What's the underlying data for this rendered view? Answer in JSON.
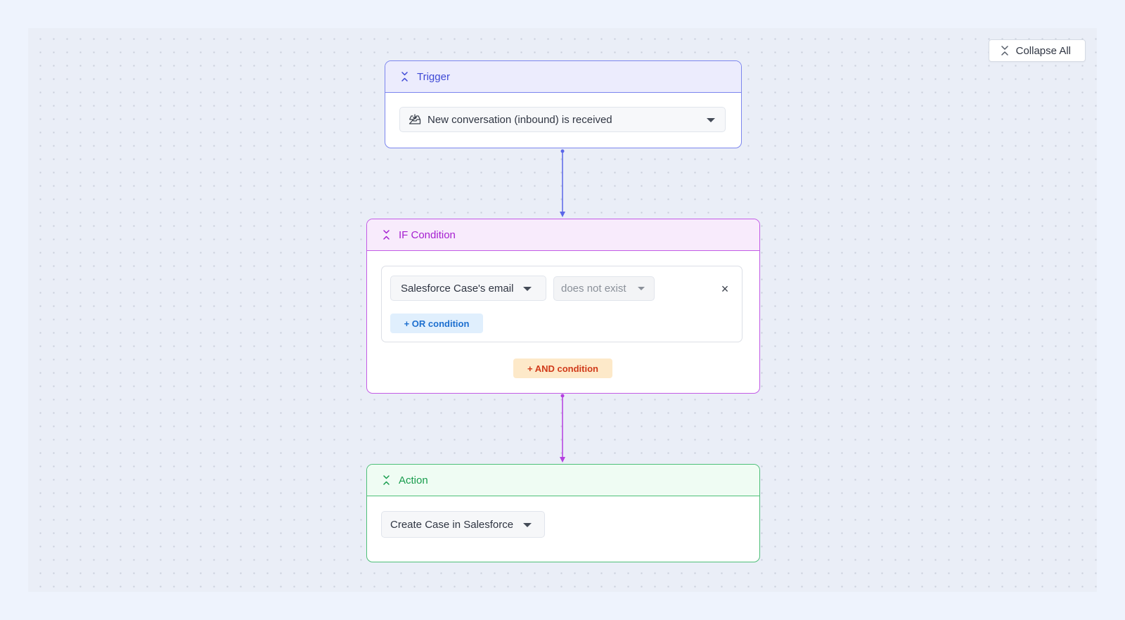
{
  "toolbar": {
    "collapse_all_label": "Collapse All"
  },
  "trigger": {
    "title": "Trigger",
    "selected_event": "New conversation (inbound) is received",
    "event_icon": "inbox-download-icon"
  },
  "if_condition": {
    "title": "IF Condition",
    "field_value": "Salesforce Case's email",
    "operator_value": "does not exist",
    "remove_label": "×",
    "or_condition_label": "+ OR condition",
    "and_condition_label": "+ AND condition"
  },
  "action": {
    "title": "Action",
    "selected_action": "Create Case in Salesforce"
  },
  "colors": {
    "trigger": "#5b66e8",
    "condition": "#b43fe0",
    "action": "#2fb36a",
    "canvas": "#eaeef7"
  }
}
